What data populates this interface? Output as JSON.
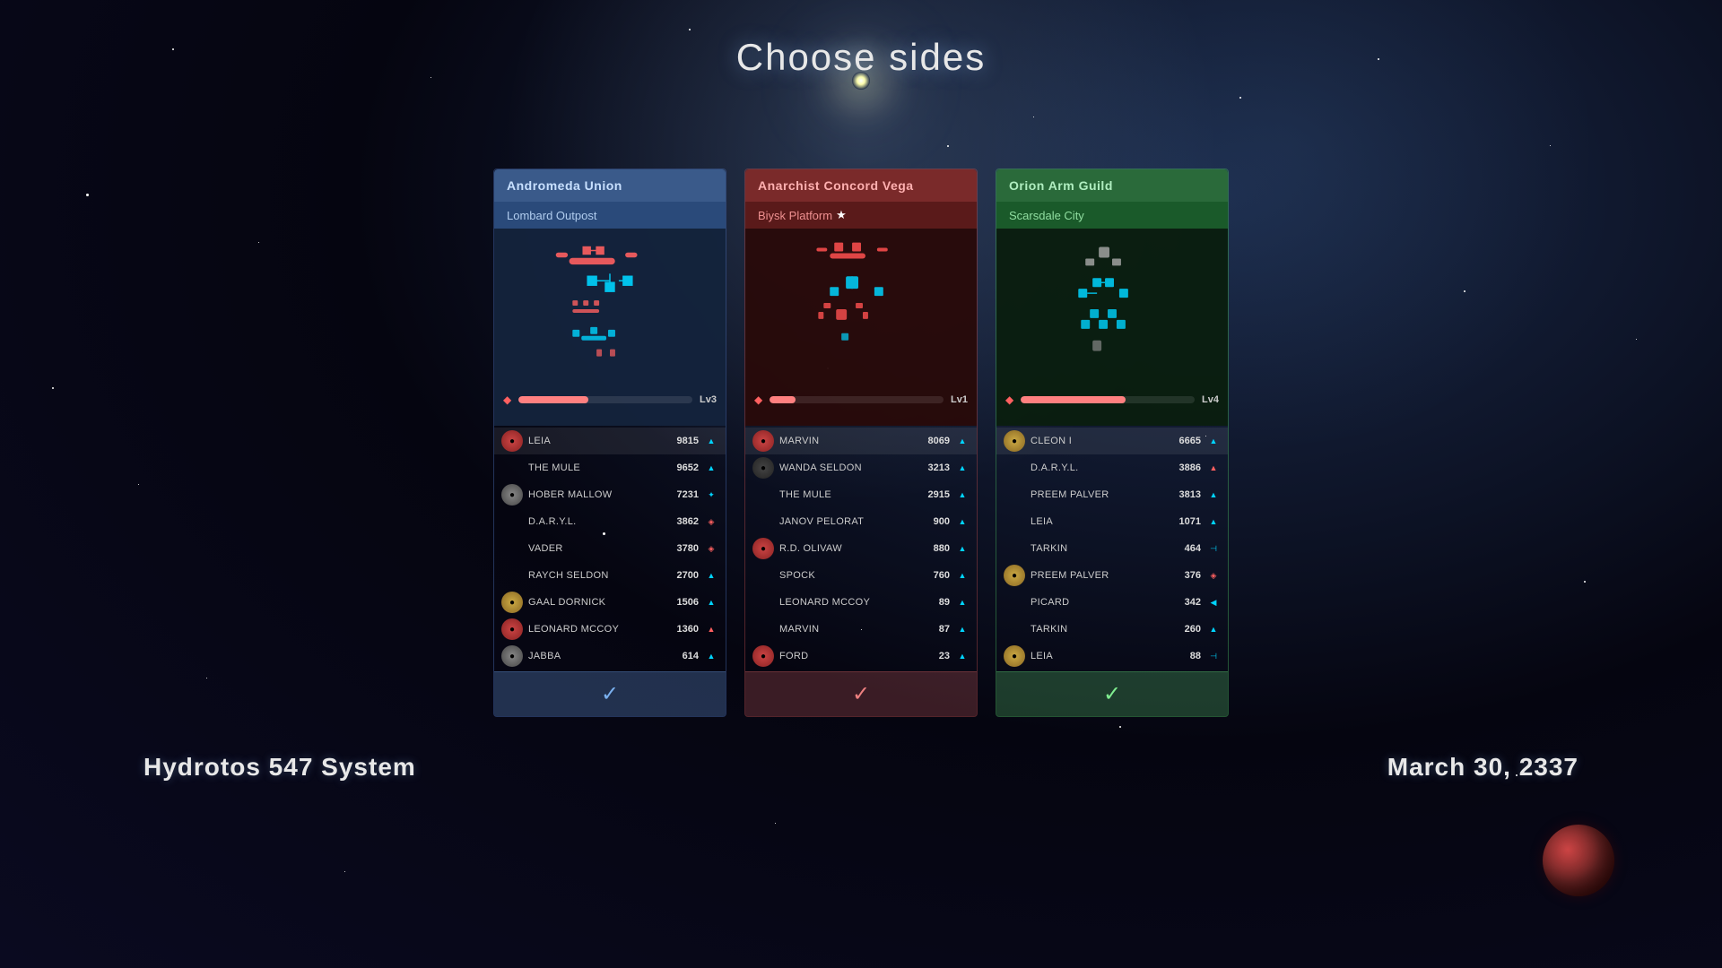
{
  "title": "Choose sides",
  "subtitle_left": "Hydrotos 547 System",
  "subtitle_right": "March 30, 2337",
  "factions": [
    {
      "id": "andromeda",
      "name": "Andromeda Union",
      "location": "Lombard Outpost",
      "level": "Lv3",
      "level_pct": 40,
      "bar_color": "#ff8080",
      "tab_bg": "#3a5a8a",
      "tab_color": "#c8e0ff",
      "sub_bg": "#2a4a7a",
      "sub_color": "#b0ccee",
      "body_bg": "rgba(20,35,60,0.97)",
      "select_bg": "rgba(100,150,220,0.3)",
      "check_color": "#7ab0ee",
      "players": [
        {
          "name": "LEIA",
          "score": "9815",
          "avatar": "av-red",
          "icon": "▲",
          "icon_color": "blue",
          "highlight": true
        },
        {
          "name": "THE MULE",
          "score": "9652",
          "avatar": "av-empty",
          "icon": "▲",
          "icon_color": "blue",
          "highlight": false
        },
        {
          "name": "HOBER MALLOW",
          "score": "7231",
          "avatar": "av-gray",
          "icon": "✦",
          "icon_color": "blue",
          "highlight": false
        },
        {
          "name": "D.A.R.Y.L.",
          "score": "3862",
          "avatar": "av-empty",
          "icon": "◈",
          "icon_color": "red",
          "highlight": false
        },
        {
          "name": "VADER",
          "score": "3780",
          "avatar": "av-empty",
          "icon": "◈",
          "icon_color": "red",
          "highlight": false
        },
        {
          "name": "RAYCH SELDON",
          "score": "2700",
          "avatar": "av-empty",
          "icon": "▲",
          "icon_color": "blue",
          "highlight": false
        },
        {
          "name": "GAAL DORNICK",
          "score": "1506",
          "avatar": "av-gold",
          "icon": "▲",
          "icon_color": "blue",
          "highlight": false
        },
        {
          "name": "LEONARD MCCOY",
          "score": "1360",
          "avatar": "av-red",
          "icon": "▲",
          "icon_color": "red",
          "highlight": false
        },
        {
          "name": "JABBA",
          "score": "614",
          "avatar": "av-gray",
          "icon": "▲",
          "icon_color": "blue",
          "highlight": false
        }
      ]
    },
    {
      "id": "anarchist",
      "name": "Anarchist Concord Vega",
      "location": "Biysk Platform",
      "level": "Lv1",
      "level_pct": 15,
      "bar_color": "#ff8080",
      "tab_bg": "#7a2a2a",
      "tab_color": "#ffb0b0",
      "sub_bg": "#5a1a1a",
      "sub_color": "#ee9090",
      "body_bg": "rgba(40,10,10,0.97)",
      "select_bg": "rgba(220,100,100,0.25)",
      "check_color": "#ee8080",
      "players": [
        {
          "name": "MARVIN",
          "score": "8069",
          "avatar": "av-red",
          "icon": "▲",
          "icon_color": "blue",
          "highlight": true
        },
        {
          "name": "WANDA SELDON",
          "score": "3213",
          "avatar": "av-dark",
          "icon": "▲",
          "icon_color": "blue",
          "highlight": false
        },
        {
          "name": "THE MULE",
          "score": "2915",
          "avatar": "av-empty",
          "icon": "▲",
          "icon_color": "blue",
          "highlight": false
        },
        {
          "name": "JANOV PELORAT",
          "score": "900",
          "avatar": "av-empty",
          "icon": "▲",
          "icon_color": "blue",
          "highlight": false
        },
        {
          "name": "R.D. OLIVAW",
          "score": "880",
          "avatar": "av-red",
          "icon": "▲",
          "icon_color": "blue",
          "highlight": false
        },
        {
          "name": "SPOCK",
          "score": "760",
          "avatar": "av-empty",
          "icon": "▲",
          "icon_color": "blue",
          "highlight": false
        },
        {
          "name": "LEONARD MCCOY",
          "score": "89",
          "avatar": "av-empty",
          "icon": "▲",
          "icon_color": "blue",
          "highlight": false
        },
        {
          "name": "MARVIN",
          "score": "87",
          "avatar": "av-empty",
          "icon": "▲",
          "icon_color": "blue",
          "highlight": false
        },
        {
          "name": "FORD",
          "score": "23",
          "avatar": "av-red",
          "icon": "▲",
          "icon_color": "blue",
          "highlight": false
        }
      ]
    },
    {
      "id": "orion",
      "name": "Orion Arm Guild",
      "location": "Scarsdale City",
      "level": "Lv4",
      "level_pct": 60,
      "bar_color": "#ff8080",
      "tab_bg": "#2a6a3a",
      "tab_color": "#b0eec0",
      "sub_bg": "#1a5a2a",
      "sub_color": "#90dda0",
      "body_bg": "rgba(10,30,15,0.97)",
      "select_bg": "rgba(100,220,120,0.25)",
      "check_color": "#80ee90",
      "players": [
        {
          "name": "CLEON I",
          "score": "6665",
          "avatar": "av-gold",
          "icon": "▲",
          "icon_color": "blue",
          "highlight": true
        },
        {
          "name": "D.A.R.Y.L.",
          "score": "3886",
          "avatar": "av-empty",
          "icon": "▲",
          "icon_color": "red",
          "highlight": false
        },
        {
          "name": "PREEM PALVER",
          "score": "3813",
          "avatar": "av-empty",
          "icon": "▲",
          "icon_color": "blue",
          "highlight": false
        },
        {
          "name": "LEIA",
          "score": "1071",
          "avatar": "av-empty",
          "icon": "▲",
          "icon_color": "blue",
          "highlight": false
        },
        {
          "name": "TARKIN",
          "score": "464",
          "avatar": "av-empty",
          "icon": "⊣",
          "icon_color": "blue",
          "highlight": false
        },
        {
          "name": "PREEM PALVER",
          "score": "376",
          "avatar": "av-gold",
          "icon": "◈",
          "icon_color": "red",
          "highlight": false
        },
        {
          "name": "PICARD",
          "score": "342",
          "avatar": "av-empty",
          "icon": "◀",
          "icon_color": "blue",
          "highlight": false
        },
        {
          "name": "TARKIN",
          "score": "260",
          "avatar": "av-empty",
          "icon": "▲",
          "icon_color": "blue",
          "highlight": false
        },
        {
          "name": "LEIA",
          "score": "88",
          "avatar": "av-gold",
          "icon": "⊣",
          "icon_color": "blue",
          "highlight": false
        }
      ]
    }
  ]
}
